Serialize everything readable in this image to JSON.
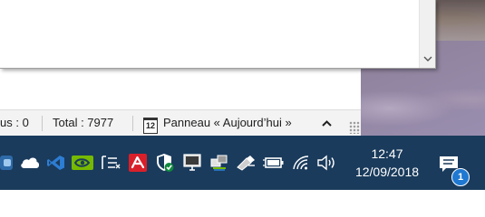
{
  "statusbar": {
    "rappels_partial": "us : 0",
    "total": "Total : 7977",
    "calendar_day": "12",
    "panel": "Panneau « Aujourd’hui »"
  },
  "taskbar": {
    "icons": [
      "app-partial-icon",
      "onedrive-cloud-icon",
      "visual-studio-icon",
      "nvidia-icon",
      "action-center-list-icon",
      "avira-icon",
      "windows-defender-icon",
      "monitor-icon",
      "network-tray-icon",
      "safely-remove-hardware-icon",
      "battery-icon",
      "wifi-icon",
      "volume-icon",
      "notification-center-icon"
    ],
    "clock_time": "12:47",
    "clock_date": "12/09/2018",
    "notification_count": "1"
  },
  "colors": {
    "taskbar": "#1a3b5c",
    "avira_red": "#d9202a",
    "nvidia_green": "#76b900",
    "accent_blue": "#1f78d1"
  }
}
